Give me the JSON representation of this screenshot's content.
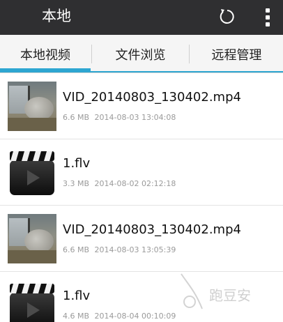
{
  "header": {
    "title": "本地",
    "refresh_icon": "refresh-icon",
    "more_icon": "overflow-menu-icon"
  },
  "tabs": [
    {
      "label": "本地视频",
      "active": true
    },
    {
      "label": "文件浏览",
      "active": false
    },
    {
      "label": "远程管理",
      "active": false
    }
  ],
  "colors": {
    "actionbar": "#2f2f31",
    "accent": "#2ea6d1",
    "meta_text": "#9a9a9a"
  },
  "files": [
    {
      "name": "VID_20140803_130402.mp4",
      "size": "6.6 MB",
      "date": "2014-08-03 13:04:08",
      "thumb": "video-thumbnail"
    },
    {
      "name": "1.flv",
      "size": "3.3 MB",
      "date": "2014-08-02 02:12:18",
      "thumb": "clapperboard-icon"
    },
    {
      "name": "VID_20140803_130402.mp4",
      "size": "6.6 MB",
      "date": "2014-08-03 13:05:39",
      "thumb": "video-thumbnail"
    },
    {
      "name": "1.flv",
      "size": "4.6 MB",
      "date": "2014-08-04 00:10:09",
      "thumb": "clapperboard-icon"
    }
  ],
  "watermark": {
    "text": "跑豆安"
  }
}
